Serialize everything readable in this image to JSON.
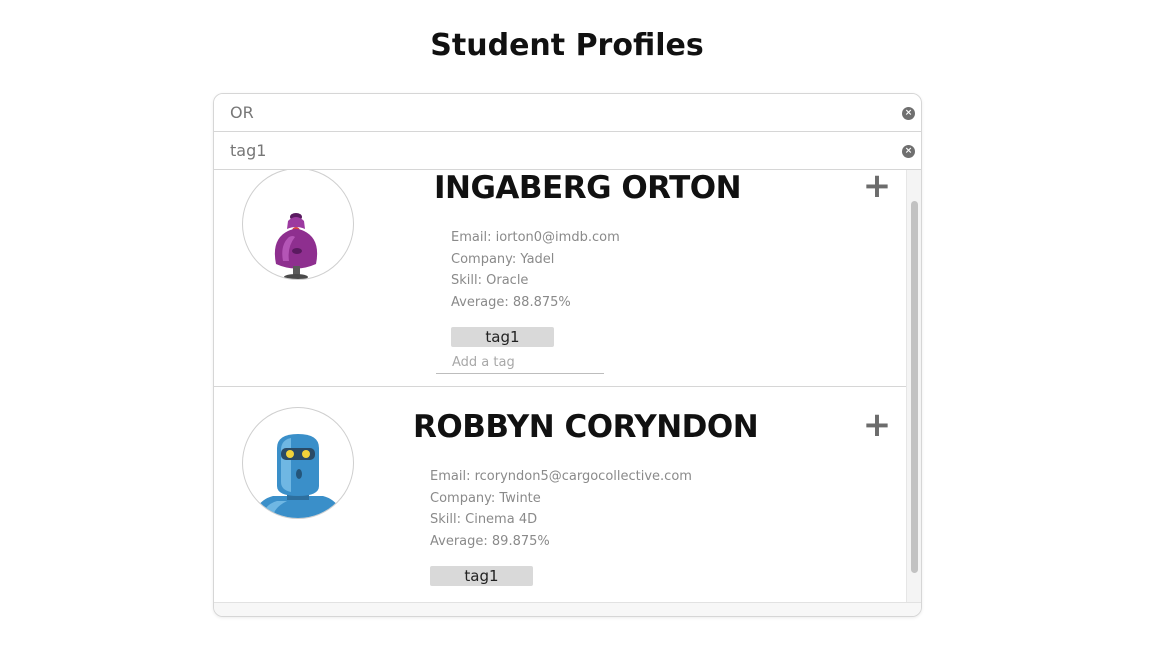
{
  "page": {
    "title": "Student Profiles"
  },
  "filters": {
    "name_search": {
      "value": "OR",
      "clear_label": "×"
    },
    "tag_search": {
      "value": "tag1",
      "clear_label": "×"
    }
  },
  "students": [
    {
      "name": "INGABERG ORTON",
      "email": "Email: iorton0@imdb.com",
      "company": "Company: Yadel",
      "skill": "Skill: Oracle",
      "average": "Average: 88.875%",
      "tags": [
        "tag1"
      ],
      "add_tag_placeholder": "Add a tag",
      "expand_label": "+",
      "avatar_icon": "purple-robot-icon"
    },
    {
      "name": "ROBBYN CORYNDON",
      "email": "Email: rcoryndon5@cargocollective.com",
      "company": "Company: Twinte",
      "skill": "Skill: Cinema 4D",
      "average": "Average: 89.875%",
      "tags": [
        "tag1"
      ],
      "expand_label": "+",
      "avatar_icon": "blue-robot-icon"
    }
  ],
  "colors": {
    "accent_purple": "#8e2f8f",
    "accent_blue": "#3a8fc9",
    "tag_bg": "#d9d9d9",
    "border": "#d6d6d6"
  }
}
